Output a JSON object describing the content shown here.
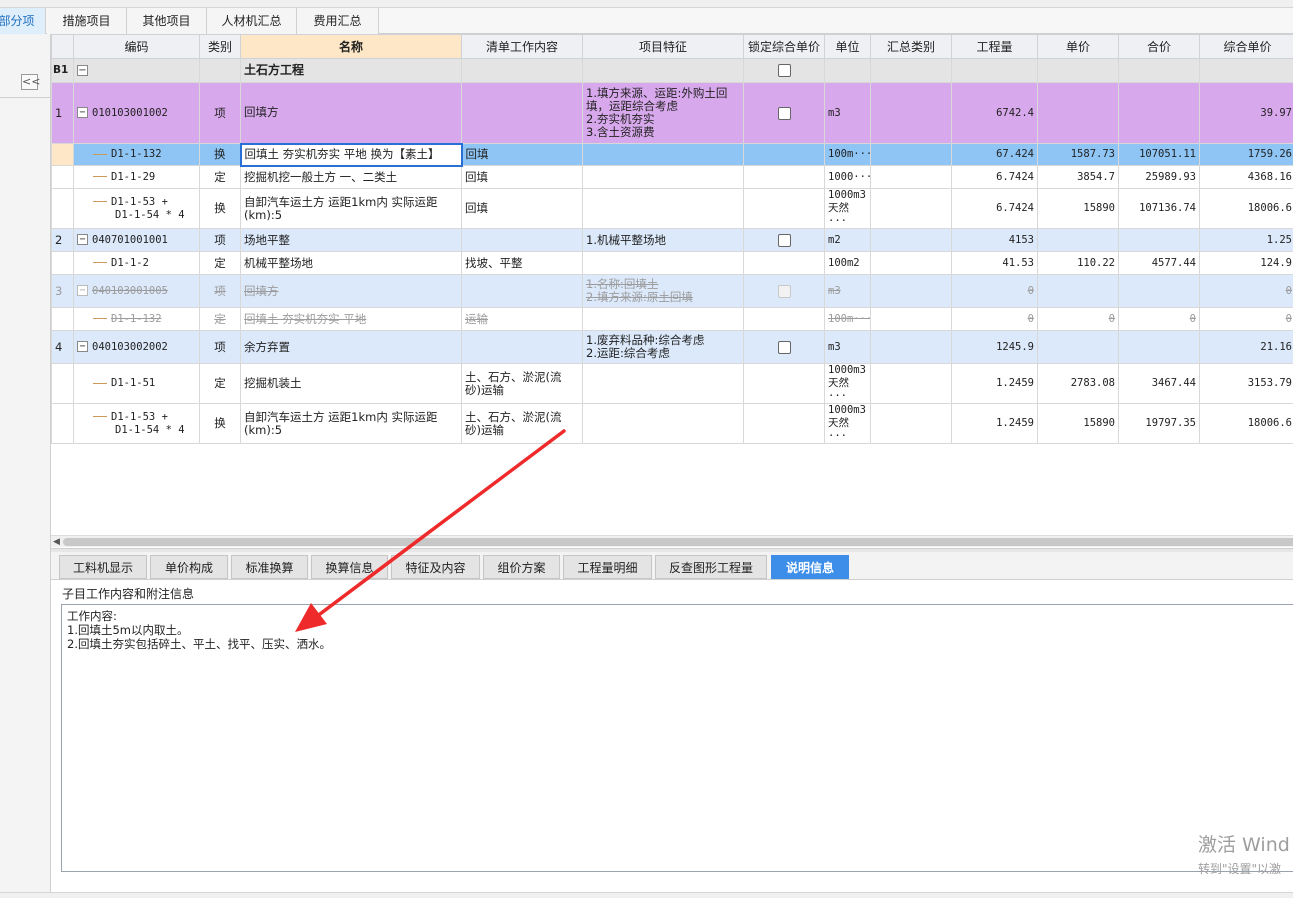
{
  "tabs": [
    "部分项",
    "措施项目",
    "其他项目",
    "人材机汇总",
    "费用汇总"
  ],
  "collapse_glyph": "<<",
  "grid": {
    "headers": [
      "",
      "编码",
      "类别",
      "名称",
      "清单工作内容",
      "项目特征",
      "锁定综合单价",
      "单位",
      "汇总类别",
      "工程量",
      "单价",
      "合价",
      "综合单价"
    ],
    "section": {
      "no": "B1",
      "name": "土石方工程"
    },
    "rows": [
      {
        "no": "1",
        "code": "010103001002",
        "type": "项",
        "name": "回填方",
        "work": "",
        "features": [
          "1.填方来源、运距:外购土回",
          "填，运距综合考虑",
          "2.夯实机夯实",
          "3.含土资源费"
        ],
        "unit": "m3",
        "qty": "6742.4",
        "price": "",
        "total": "",
        "comp": "39.97"
      },
      {
        "code": "D1-1-132",
        "type": "换",
        "name": "回填土 夯实机夯实 平地  换为【素土】",
        "work": "回填",
        "unit": "100m···",
        "qty": "67.424",
        "price": "1587.73",
        "total": "107051.11",
        "comp": "1759.26"
      },
      {
        "code": "D1-1-29",
        "type": "定",
        "name": "挖掘机挖一般土方 一、二类土",
        "work": "回填",
        "unit": "1000···",
        "qty": "6.7424",
        "price": "3854.7",
        "total": "25989.93",
        "comp": "4368.16"
      },
      {
        "code": [
          "D1-1-53 +",
          "D1-1-54 * 4"
        ],
        "type": "换",
        "name": [
          "自卸汽车运土方 运距1km内  实际运距",
          "(km):5"
        ],
        "work": "回填",
        "unit": [
          "1000m3",
          "天然···"
        ],
        "qty": "6.7424",
        "price": "15890",
        "total": "107136.74",
        "comp": "18006.6"
      },
      {
        "no": "2",
        "code": "040701001001",
        "type": "项",
        "name": "场地平整",
        "work": "",
        "features": [
          "1.机械平整场地"
        ],
        "unit": "m2",
        "qty": "4153",
        "price": "",
        "total": "",
        "comp": "1.25"
      },
      {
        "code": "D1-1-2",
        "type": "定",
        "name": "机械平整场地",
        "work": "找坡、平整",
        "unit": "100m2",
        "qty": "41.53",
        "price": "110.22",
        "total": "4577.44",
        "comp": "124.9"
      },
      {
        "no": "3",
        "code": "040103001005",
        "type": "项",
        "name": "回填方",
        "work": "",
        "features": [
          "1.名称:回填土",
          "2.填方来源:原土回填"
        ],
        "unit": "m3",
        "qty": "0",
        "price": "",
        "total": "",
        "comp": "0"
      },
      {
        "code": "D1-1-132",
        "type": "定",
        "name": "回填土 夯实机夯实 平地",
        "work": "运输",
        "unit": "100m···",
        "qty": "0",
        "price": "0",
        "total": "0",
        "comp": "0"
      },
      {
        "no": "4",
        "code": "040103002002",
        "type": "项",
        "name": "余方弃置",
        "work": "",
        "features": [
          "1.废弃料品种:综合考虑",
          "2.运距:综合考虑"
        ],
        "unit": "m3",
        "qty": "1245.9",
        "price": "",
        "total": "",
        "comp": "21.16"
      },
      {
        "code": "D1-1-51",
        "type": "定",
        "name": "挖掘机装土",
        "work": [
          "土、石方、淤泥(流",
          "砂)运输"
        ],
        "unit": [
          "1000m3",
          "天然···"
        ],
        "qty": "1.2459",
        "price": "2783.08",
        "total": "3467.44",
        "comp": "3153.79"
      },
      {
        "code": [
          "D1-1-53 +",
          "D1-1-54 * 4"
        ],
        "type": "换",
        "name": [
          "自卸汽车运土方 运距1km内  实际运距",
          "(km):5"
        ],
        "work": [
          "土、石方、淤泥(流",
          "砂)运输"
        ],
        "unit": [
          "1000m3",
          "天然···"
        ],
        "qty": "1.2459",
        "price": "15890",
        "total": "19797.35",
        "comp": "18006.6"
      }
    ]
  },
  "bottom_tabs": [
    "工料机显示",
    "单价构成",
    "标准换算",
    "换算信息",
    "特征及内容",
    "组价方案",
    "工程量明细",
    "反查图形工程量",
    "说明信息"
  ],
  "note": {
    "title": "子目工作内容和附注信息",
    "lines": [
      "工作内容:",
      "1.回填土5m以内取土。",
      "2.回填土夯实包括碎土、平土、找平、压实、洒水。"
    ]
  },
  "watermark": {
    "line1": "激活 Wind",
    "line2": "转到\"设置\"以激"
  },
  "colors": {
    "accent": "#3d8ee8",
    "selected_row": "#8ec5f5",
    "item_row": "#d8a8ec",
    "light_row": "#dce9fb",
    "arrow": "#ee2a2a"
  }
}
